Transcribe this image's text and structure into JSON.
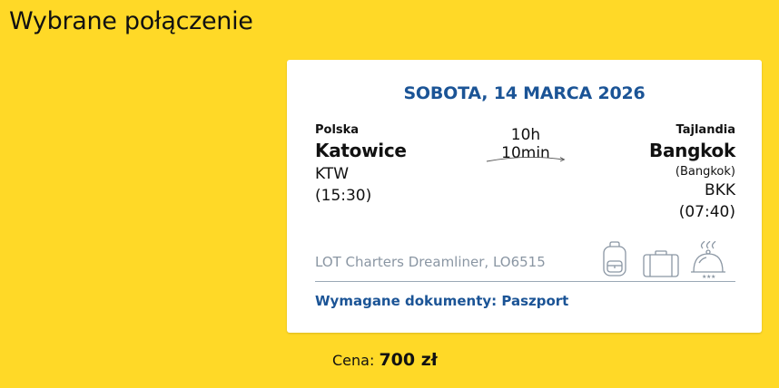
{
  "page": {
    "title": "Wybrane połączenie"
  },
  "flight": {
    "date": "SOBOTA, 14 MARCA 2026",
    "origin": {
      "country": "Polska",
      "city": "Katowice",
      "code": "KTW",
      "time": "(15:30)"
    },
    "destination": {
      "country": "Tajlandia",
      "city": "Bangkok",
      "subcity": "(Bangkok)",
      "code": "BKK",
      "time": "(07:40)"
    },
    "duration": "10h 10min",
    "aircraft": "LOT Charters Dreamliner, LO6515",
    "documents": "Wymagane dokumenty: Paszport",
    "amenities": [
      "backpack-icon",
      "suitcase-icon",
      "meal-cloche-icon"
    ]
  },
  "price": {
    "label": "Cena:",
    "value": "700 zł"
  },
  "colors": {
    "background": "#ffd927",
    "accent": "#1b5496",
    "muted": "#8a96a3"
  }
}
